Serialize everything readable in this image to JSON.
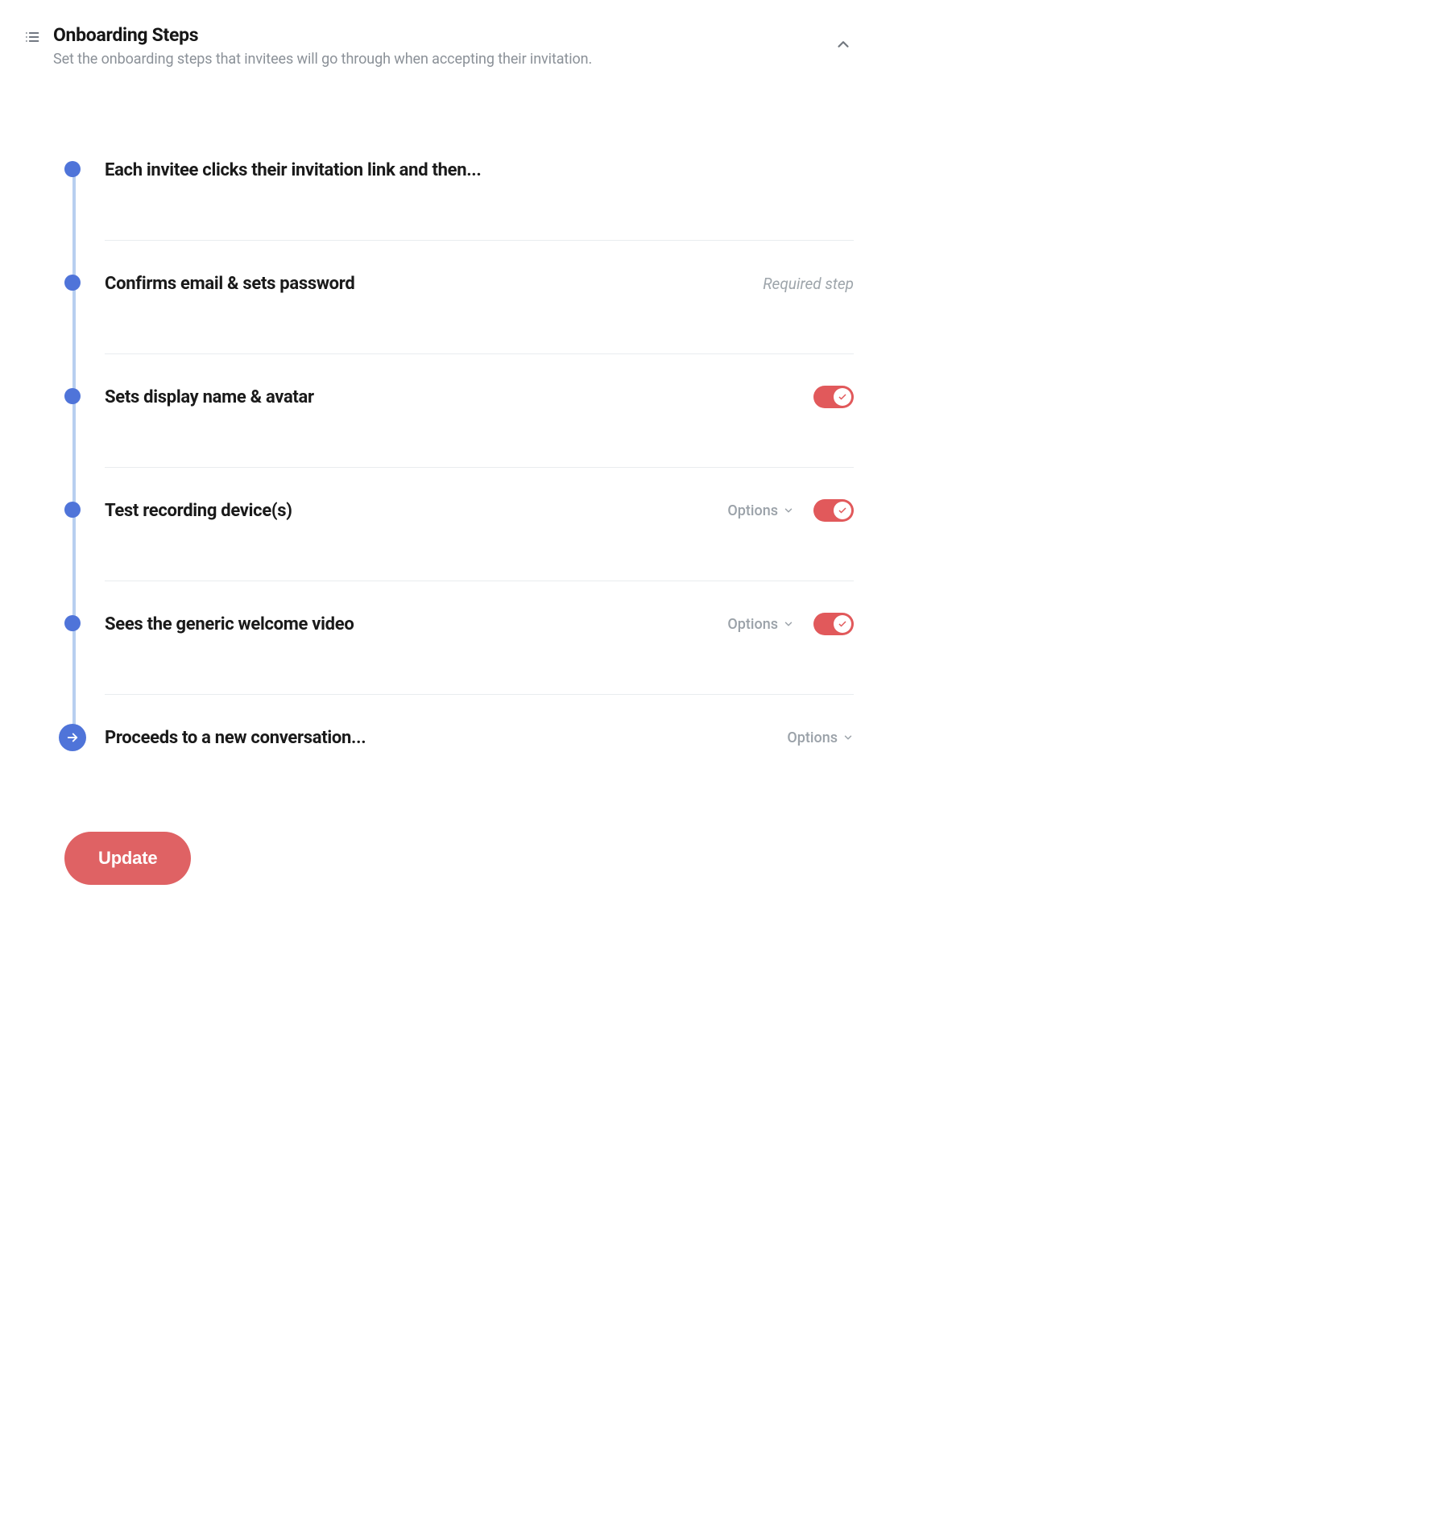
{
  "header": {
    "title": "Onboarding Steps",
    "description": "Set the onboarding steps that invitees will go through when accepting their invitation."
  },
  "steps": [
    {
      "label": "Each invitee clicks their invitation link and then...",
      "required_label": "",
      "options_label": "",
      "has_toggle": false,
      "toggle_on": false,
      "final": false
    },
    {
      "label": "Confirms email & sets password",
      "required_label": "Required step",
      "options_label": "",
      "has_toggle": false,
      "toggle_on": false,
      "final": false
    },
    {
      "label": "Sets display name & avatar",
      "required_label": "",
      "options_label": "",
      "has_toggle": true,
      "toggle_on": true,
      "final": false
    },
    {
      "label": "Test recording device(s)",
      "required_label": "",
      "options_label": "Options",
      "has_toggle": true,
      "toggle_on": true,
      "final": false
    },
    {
      "label": "Sees the generic welcome video",
      "required_label": "",
      "options_label": "Options",
      "has_toggle": true,
      "toggle_on": true,
      "final": false
    },
    {
      "label": "Proceeds to a new conversation...",
      "required_label": "",
      "options_label": "Options",
      "has_toggle": false,
      "toggle_on": false,
      "final": true
    }
  ],
  "buttons": {
    "update": "Update"
  }
}
